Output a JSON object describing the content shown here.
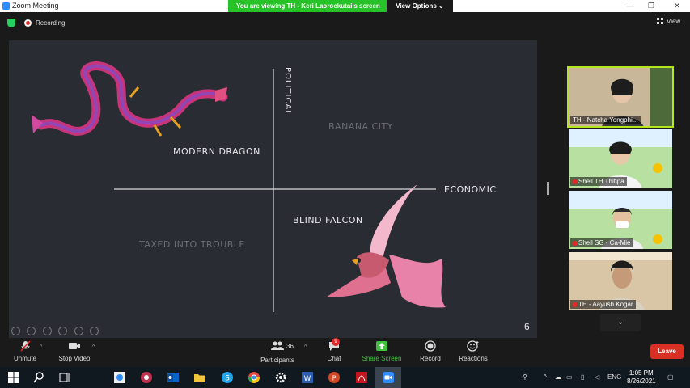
{
  "window": {
    "title": "Zoom Meeting",
    "banner": "You are viewing TH - Keri Laoroekutai's screen",
    "view_options": "View Options ⌄",
    "controls": [
      "—",
      "❐",
      "✕"
    ]
  },
  "meeting_bar": {
    "recording_label": "Recording",
    "view_label": "View"
  },
  "slide": {
    "labels": {
      "modern_dragon": "MODERN DRAGON",
      "banana_city": "BANANA CITY",
      "economic": "ECONOMIC",
      "blind_falcon": "BLIND FALCON",
      "taxed": "TAXED INTO TROUBLE",
      "political": "POLITICAL"
    },
    "page_number": "6"
  },
  "participants": [
    {
      "name": "TH - Natcha Yongphi..."
    },
    {
      "name": "Shell TH Thitipa"
    },
    {
      "name": "Shell SG - Ca-Mie"
    },
    {
      "name": "TH - Aayush Kogar"
    }
  ],
  "toolbar": {
    "unmute": "Unmute",
    "stop_video": "Stop Video",
    "participants": "Participants",
    "participants_count": "36",
    "chat": "Chat",
    "chat_badge": "9",
    "share_screen": "Share Screen",
    "record": "Record",
    "reactions": "Reactions",
    "leave": "Leave"
  },
  "taskbar": {
    "language": "ENG",
    "time": "1:05 PM",
    "date": "8/26/2021"
  }
}
